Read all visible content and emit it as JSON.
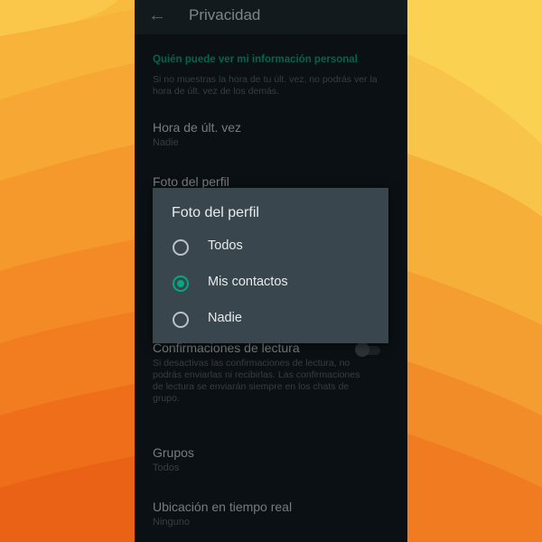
{
  "app_bar": {
    "back_icon": "arrow-left-icon",
    "title": "Privacidad"
  },
  "section": {
    "header": "Quién puede ver mi información personal",
    "description": "Si no muestras la hora de tu últ. vez, no podrás ver la hora de últ. vez de los demás."
  },
  "items": [
    {
      "title": "Hora de últ. vez",
      "value": "Nadie"
    },
    {
      "title": "Foto del perfil"
    },
    {
      "title": "Confirmaciones de lectura",
      "description": "Si desactivas las confirmaciones de lectura, no podrás enviarlas ni recibirlas. Las confirmaciones de lectura se enviarán siempre en los chats de grupo.",
      "toggle_on": false
    },
    {
      "title": "Grupos",
      "value": "Todos"
    },
    {
      "title": "Ubicación en tiempo real",
      "value": "Ninguno"
    }
  ],
  "dialog": {
    "title": "Foto del perfil",
    "options": [
      {
        "label": "Todos",
        "selected": false
      },
      {
        "label": "Mis contactos",
        "selected": true
      },
      {
        "label": "Nadie",
        "selected": false
      }
    ]
  },
  "colors": {
    "accent": "#00a884",
    "background": "#121b21",
    "dialog": "#3a464d",
    "wallpaper": "#f6a531"
  }
}
